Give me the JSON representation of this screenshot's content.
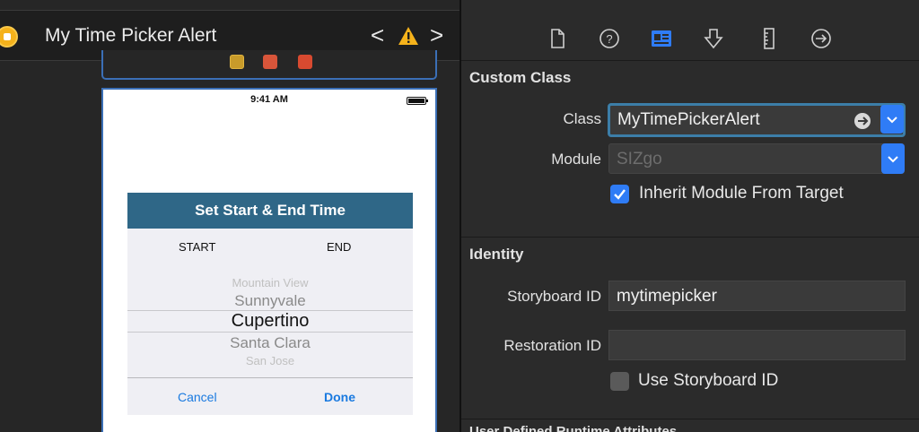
{
  "canvas": {
    "title": "My Time Picker Alert",
    "nav_prev": "<",
    "nav_next": ">",
    "status_time": "9:41 AM",
    "alert": {
      "header": "Set Start & End Time",
      "start_label": "START",
      "end_label": "END",
      "picker_items": [
        "Mountain View",
        "Sunnyvale",
        "Cupertino",
        "Santa Clara",
        "San Jose"
      ],
      "selected_item": "Cupertino",
      "cancel": "Cancel",
      "done": "Done"
    }
  },
  "inspector": {
    "toolbar_icons": [
      "file-inspector-icon",
      "quick-help-icon",
      "identity-inspector-icon",
      "attributes-inspector-icon",
      "size-inspector-icon",
      "connections-inspector-icon"
    ],
    "active_tab": "identity-inspector-icon",
    "custom_class": {
      "section_title": "Custom Class",
      "class_label": "Class",
      "class_value": "MyTimePickerAlert",
      "module_label": "Module",
      "module_placeholder": "SIZgo",
      "inherit_label": "Inherit Module From Target",
      "inherit_checked": true
    },
    "identity": {
      "section_title": "Identity",
      "storyboard_id_label": "Storyboard ID",
      "storyboard_id_value": "mytimepicker",
      "restoration_id_label": "Restoration ID",
      "restoration_id_value": "",
      "use_storyboard_label": "Use Storyboard ID",
      "use_storyboard_checked": false
    },
    "next_section_partial": "User Defined Runtime Attributes"
  },
  "colors": {
    "accent": "#2f7cf6",
    "alert_header": "#2f6787",
    "link_blue": "#1a7ae0",
    "warning": "#f5b21b"
  }
}
